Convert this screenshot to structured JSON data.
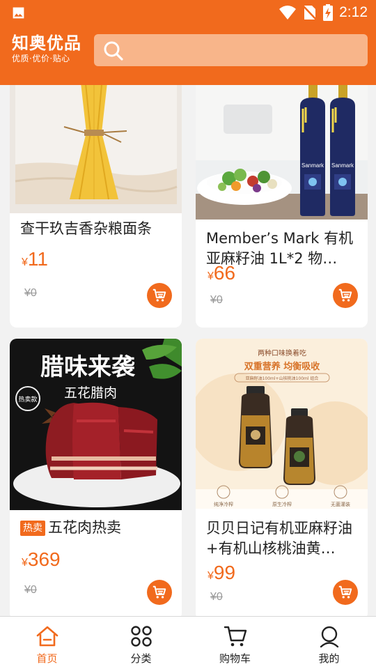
{
  "status_bar": {
    "time": "2:12",
    "icons": [
      "image-icon",
      "wifi-icon",
      "no-sim-icon",
      "battery-charging-icon"
    ]
  },
  "header": {
    "logo_title": "知奥优品",
    "logo_subtitle": "优质·优价·贴心",
    "search_icon": "search-icon",
    "search_placeholder": ""
  },
  "products": [
    {
      "title": "查干玖吉香杂粮面条",
      "tag": "",
      "currency": "¥",
      "price": "11",
      "original_price": "¥0"
    },
    {
      "title": "Member’s Mark 有机亚麻籽油 1L*2 物…",
      "tag": "",
      "currency": "¥",
      "price": "66",
      "original_price": "¥0"
    },
    {
      "title": "五花肉热卖",
      "tag": "热卖",
      "currency": "¥",
      "price": "369",
      "original_price": "¥0"
    },
    {
      "title": "贝贝日记有机亚麻籽油+有机山核桃油黄…",
      "tag": "",
      "currency": "¥",
      "price": "99",
      "original_price": "¥0"
    }
  ],
  "product_images": {
    "bacon_heading": "腊味来袭",
    "bacon_subheading": "五花腊肉",
    "bacon_stamp": "热卖款",
    "oil_ad_small": "两种口味换着吃",
    "oil_ad_heading": "双重营养 均衡吸收",
    "oil_ad_sub": "亚麻籽油100ml+山核桃油100ml 组合",
    "oil_ad_features": [
      "纯净冷榨",
      "原生冷榨",
      "无菌灌装"
    ],
    "bottle_brand": "Sanmark"
  },
  "tab_bar": {
    "items": [
      {
        "label": "首页",
        "icon": "home-icon",
        "active": true
      },
      {
        "label": "分类",
        "icon": "category-grid-icon",
        "active": false
      },
      {
        "label": "购物车",
        "icon": "cart-icon",
        "active": false
      },
      {
        "label": "我的",
        "icon": "profile-icon",
        "active": false
      }
    ]
  },
  "colors": {
    "accent": "#f16a1d",
    "search_bg": "#f8b58a",
    "page_bg": "#f2f2f2"
  }
}
